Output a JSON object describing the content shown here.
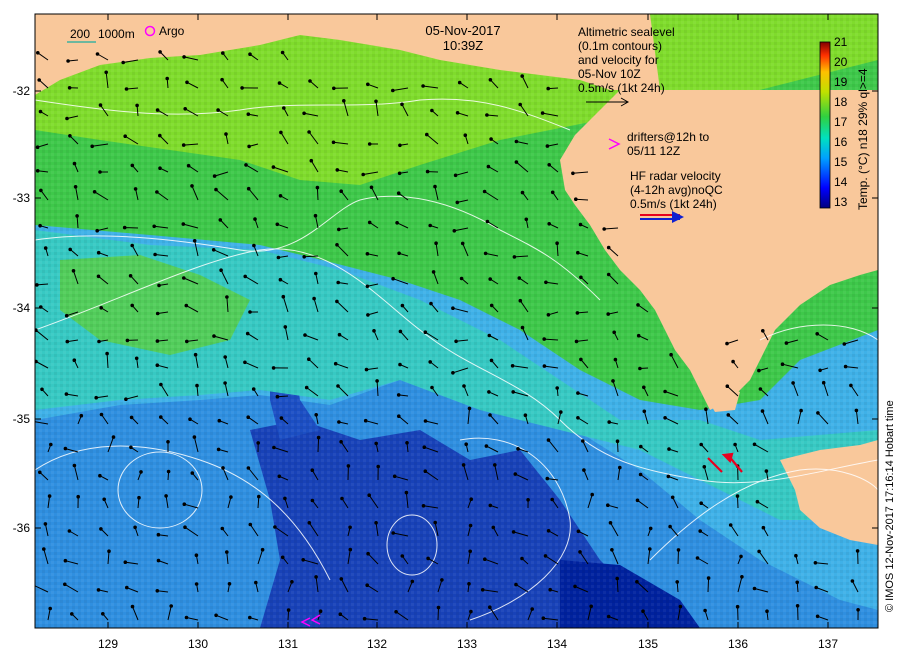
{
  "header": {
    "date": "05-Nov-2017",
    "time": "10:39Z"
  },
  "legend": {
    "bathymetry_200": "200",
    "bathymetry_1000": "1000m",
    "argo_label": "Argo",
    "altimetry_lines": [
      "Altimetric sealevel",
      "(0.1m contours)",
      "and velocity for",
      "05-Nov 10Z",
      "0.5m/s (1kt 24h)"
    ],
    "drifter_lines": [
      "drifters@12h to",
      "05/11 12Z"
    ],
    "hf_radar_lines": [
      "HF radar velocity",
      "(4-12h avg)noQC",
      "0.5m/s (1kt 24h)"
    ]
  },
  "colorbar": {
    "title": "Temp. (°C) n18 29% ql>=4",
    "ticks": [
      "21",
      "20",
      "19",
      "18",
      "17",
      "16",
      "15",
      "14",
      "13"
    ],
    "range": [
      13,
      21
    ]
  },
  "axes": {
    "x_ticks": [
      "129",
      "130",
      "131",
      "132",
      "133",
      "134",
      "135",
      "136",
      "137"
    ],
    "y_ticks": [
      "-32",
      "-33",
      "-34",
      "-35",
      "-36"
    ]
  },
  "credit": "© IMOS 12-Nov-2017 17:16:14 Hobart time",
  "colors": {
    "land": "#f9c89b",
    "deep_blue": "#00229e",
    "mid_blue": "#1f6fd6",
    "light_blue": "#3fb1e8",
    "cyan": "#37c9c3",
    "green": "#3ec84a",
    "lime": "#7fdc2c",
    "contour": "#ffffff",
    "argo": "#ff00ff",
    "hf_red": "#e8001f"
  }
}
